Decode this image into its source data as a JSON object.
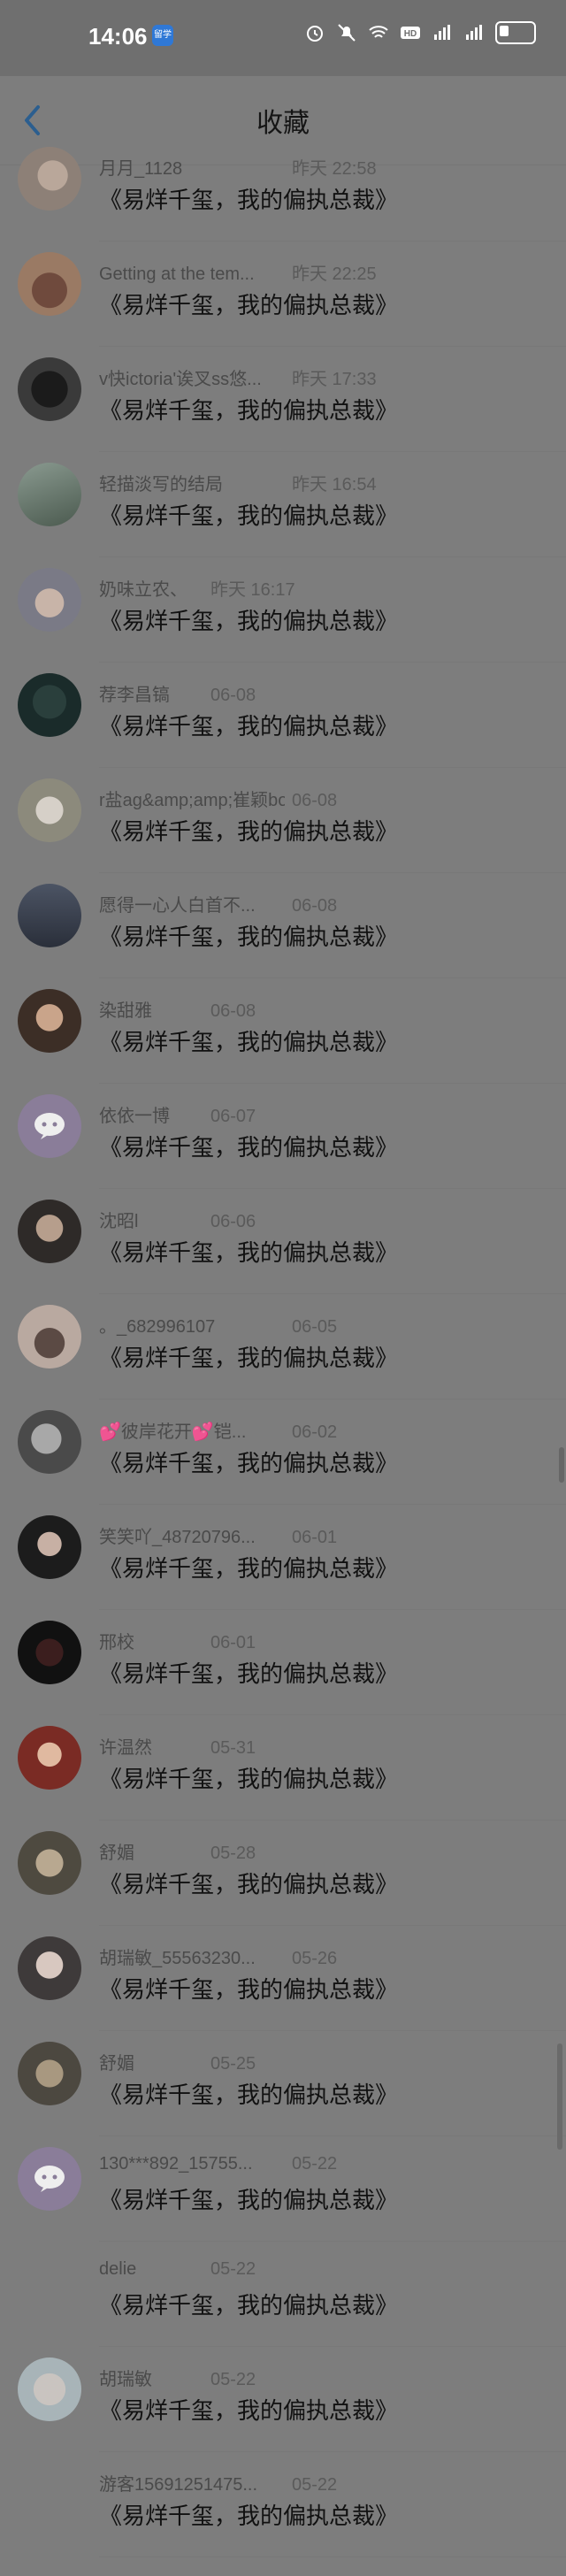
{
  "status_bar": {
    "time": "14:06",
    "app_badge": "留学",
    "icons": [
      "alarm-icon",
      "mute-icon",
      "wifi-icon",
      "hd-icon",
      "signal-icon",
      "signal-icon",
      "battery-icon"
    ]
  },
  "header": {
    "title": "收藏",
    "back_icon": "chevron-left-icon"
  },
  "items": [
    {
      "name": "月月_1128",
      "time": "昨天 22:58",
      "title": "《易烊千玺，我的偏执总裁》",
      "avatar": "photo-1"
    },
    {
      "name": "Getting at the tem...",
      "time": "昨天 22:25",
      "title": "《易烊千玺，我的偏执总裁》",
      "avatar": "photo-2"
    },
    {
      "name": "v快ictoria'诶叉ss悠...",
      "time": "昨天 17:33",
      "title": "《易烊千玺，我的偏执总裁》",
      "avatar": "photo-3"
    },
    {
      "name": "轻描淡写的结局",
      "time": "昨天 16:54",
      "title": "《易烊千玺，我的偏执总裁》",
      "avatar": "photo-4"
    },
    {
      "name": "奶味立农、",
      "time": "昨天 16:17",
      "title": "《易烊千玺，我的偏执总裁》",
      "avatar": "photo-5"
    },
    {
      "name": "荐李昌镐",
      "time": "06-08",
      "title": "《易烊千玺，我的偏执总裁》",
      "avatar": "photo-6"
    },
    {
      "name": "r盐ag&amp;amp;崔颖bo...",
      "time": "06-08",
      "title": "《易烊千玺，我的偏执总裁》",
      "avatar": "photo-7"
    },
    {
      "name": "愿得一心人白首不...",
      "time": "06-08",
      "title": "《易烊千玺，我的偏执总裁》",
      "avatar": "photo-8"
    },
    {
      "name": "染甜雅",
      "time": "06-08",
      "title": "《易烊千玺，我的偏执总裁》",
      "avatar": "photo-9"
    },
    {
      "name": "依依一博",
      "time": "06-07",
      "title": "《易烊千玺，我的偏执总裁》",
      "avatar": "default-avatar"
    },
    {
      "name": "沈昭l",
      "time": "06-06",
      "title": "《易烊千玺，我的偏执总裁》",
      "avatar": "photo-10"
    },
    {
      "name": "。_682996107",
      "time": "06-05",
      "title": "《易烊千玺，我的偏执总裁》",
      "avatar": "photo-11"
    },
    {
      "name": "💕彼岸花开💕铠...",
      "time": "06-02",
      "title": "《易烊千玺，我的偏执总裁》",
      "avatar": "photo-12"
    },
    {
      "name": "笑笑吖_48720796...",
      "time": "06-01",
      "title": "《易烊千玺，我的偏执总裁》",
      "avatar": "photo-13"
    },
    {
      "name": "邢校",
      "time": "06-01",
      "title": "《易烊千玺，我的偏执总裁》",
      "avatar": "photo-14"
    },
    {
      "name": "许温然",
      "time": "05-31",
      "title": "《易烊千玺，我的偏执总裁》",
      "avatar": "photo-15"
    },
    {
      "name": "舒媚",
      "time": "05-28",
      "title": "《易烊千玺，我的偏执总裁》",
      "avatar": "photo-16"
    },
    {
      "name": "胡瑞敏_55563230...",
      "time": "05-26",
      "title": "《易烊千玺，我的偏执总裁》",
      "avatar": "photo-17"
    },
    {
      "name": "舒媚",
      "time": "05-25",
      "title": "《易烊千玺，我的偏执总裁》",
      "avatar": "photo-18"
    },
    {
      "name": "130***892_15755...",
      "time": "05-22",
      "title": "《易烊千玺，我的偏执总裁》",
      "avatar": "default-avatar"
    },
    {
      "name": "delie",
      "time": "05-22",
      "title": "《易烊千玺，我的偏执总裁》",
      "avatar": "none"
    },
    {
      "name": "胡瑞敏",
      "time": "05-22",
      "title": "《易烊千玺，我的偏执总裁》",
      "avatar": "photo-19"
    },
    {
      "name": "游客15691251475...",
      "time": "05-22",
      "title": "《易烊千玺，我的偏执总裁》",
      "avatar": "none"
    }
  ]
}
